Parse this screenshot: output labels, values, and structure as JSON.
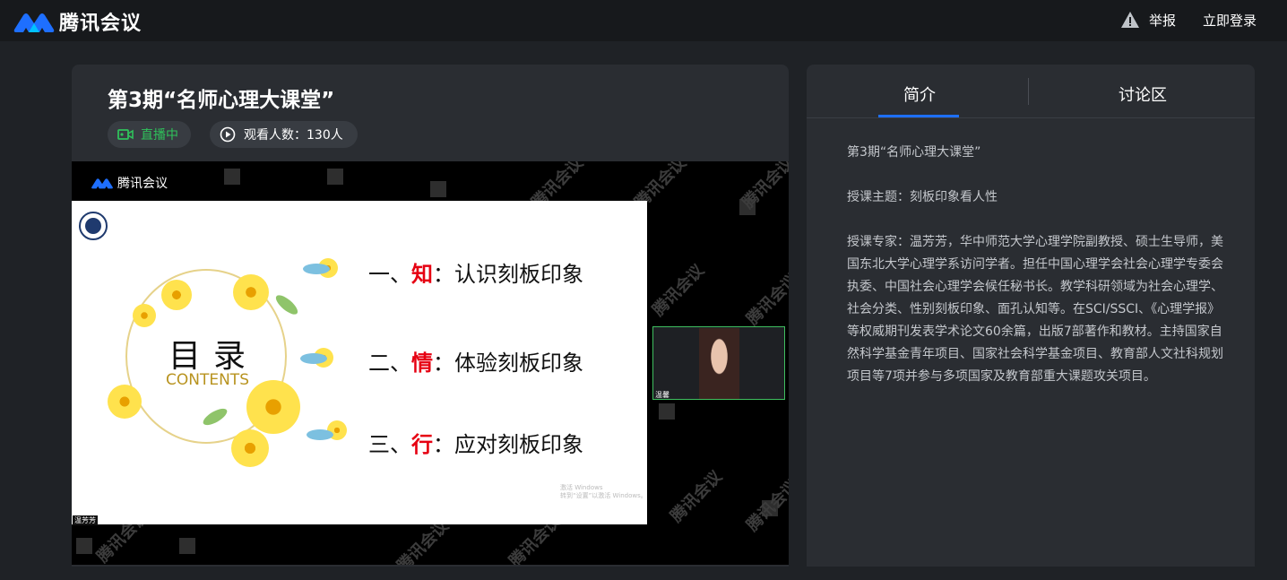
{
  "app": {
    "brand_name": "腾讯会议",
    "report_label": "举报",
    "login_label": "立即登录"
  },
  "meeting": {
    "title": "第3期“名师心理大课堂”",
    "live_label": "直播中",
    "viewers_label": "观看人数：130人"
  },
  "video": {
    "watermark_text": "腾讯会议",
    "brand_name": "腾讯会议",
    "speaker_name": "温芳芳",
    "pip_name": "温馨",
    "slide": {
      "heading": "目录",
      "subheading": "CONTENTS",
      "items": [
        {
          "prefix": "一、",
          "keyword": "知",
          "rest": "：认识刻板印象"
        },
        {
          "prefix": "二、",
          "keyword": "情",
          "rest": "：体验刻板印象"
        },
        {
          "prefix": "三、",
          "keyword": "行",
          "rest": "：应对刻板印象"
        }
      ],
      "activate_line1": "激活 Windows",
      "activate_line2": "转到“设置”以激活 Windows。"
    }
  },
  "side": {
    "tabs": [
      {
        "label": "简介",
        "active": true
      },
      {
        "label": "讨论区",
        "active": false
      }
    ],
    "intro": {
      "title": "第3期“名师心理大课堂”",
      "topic": "授课主题：刻板印象看人性",
      "expert": "授课专家：温芳芳，华中师范大学心理学院副教授、硕士生导师，美国东北大学心理学系访问学者。担任中国心理学会社会心理学专委会执委、中国社会心理学会候任秘书长。教学科研领域为社会心理学、社会分类、性别刻板印象、面孔认知等。在SCI/SSCI、《心理学报》等权威期刊发表学术论文60余篇，出版7部著作和教材。主持国家自然科学基金青年项目、国家社会科学基金项目、教育部人文社科规划项目等7项并参与多项国家及教育部重大课题攻关项目。"
    }
  },
  "colors": {
    "accent_blue": "#1e6fff",
    "live_green": "#2fc25b",
    "keyword_red": "#e60012"
  }
}
